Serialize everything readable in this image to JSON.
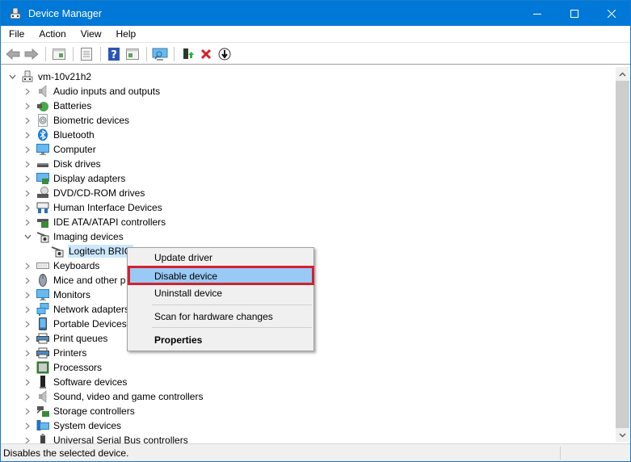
{
  "window": {
    "title": "Device Manager",
    "controls": [
      "minimize",
      "maximize",
      "close"
    ]
  },
  "menubar": {
    "items": [
      "File",
      "Action",
      "View",
      "Help"
    ]
  },
  "toolbar": {
    "buttons": [
      "back-arrow",
      "forward-arrow",
      "show-hide-console-tree",
      "properties",
      "help",
      "action-pane",
      "scan-monitor",
      "update-driver",
      "uninstall-x",
      "disable-download"
    ]
  },
  "tree": {
    "root": "vm-10v21h2",
    "categories": [
      {
        "label": "Audio inputs and outputs",
        "icon": "speaker-icon",
        "expanded": false
      },
      {
        "label": "Batteries",
        "icon": "battery-icon",
        "expanded": false
      },
      {
        "label": "Biometric devices",
        "icon": "fingerprint-icon",
        "expanded": false
      },
      {
        "label": "Bluetooth",
        "icon": "bluetooth-icon",
        "expanded": false
      },
      {
        "label": "Computer",
        "icon": "computer-icon",
        "expanded": false
      },
      {
        "label": "Disk drives",
        "icon": "disk-drive-icon",
        "expanded": false
      },
      {
        "label": "Display adapters",
        "icon": "display-adapter-icon",
        "expanded": false
      },
      {
        "label": "DVD/CD-ROM drives",
        "icon": "dvd-icon",
        "expanded": false
      },
      {
        "label": "Human Interface Devices",
        "icon": "hid-icon",
        "expanded": false
      },
      {
        "label": "IDE ATA/ATAPI controllers",
        "icon": "ide-controller-icon",
        "expanded": false
      },
      {
        "label": "Imaging devices",
        "icon": "camera-icon",
        "expanded": true
      },
      {
        "label": "Keyboards",
        "icon": "keyboard-icon",
        "expanded": false
      },
      {
        "label": "Mice and other p",
        "icon": "mouse-icon",
        "expanded": false
      },
      {
        "label": "Monitors",
        "icon": "monitor-icon",
        "expanded": false
      },
      {
        "label": "Network adapters",
        "icon": "network-icon",
        "expanded": false
      },
      {
        "label": "Portable Devices",
        "icon": "portable-device-icon",
        "expanded": false
      },
      {
        "label": "Print queues",
        "icon": "printer-icon",
        "expanded": false
      },
      {
        "label": "Printers",
        "icon": "printer-icon",
        "expanded": false
      },
      {
        "label": "Processors",
        "icon": "processor-icon",
        "expanded": false
      },
      {
        "label": "Software devices",
        "icon": "software-device-icon",
        "expanded": false
      },
      {
        "label": "Sound, video and game controllers",
        "icon": "speaker-icon",
        "expanded": false
      },
      {
        "label": "Storage controllers",
        "icon": "storage-controller-icon",
        "expanded": false
      },
      {
        "label": "System devices",
        "icon": "system-devices-icon",
        "expanded": false
      },
      {
        "label": "Universal Serial Bus controllers",
        "icon": "usb-icon",
        "expanded": false
      }
    ],
    "imaging_child": "Logitech BRIC"
  },
  "context_menu": {
    "items": [
      {
        "label": "Update driver",
        "bold": false
      },
      {
        "label": "Disable device",
        "bold": false,
        "highlighted": true
      },
      {
        "label": "Uninstall device",
        "bold": false
      },
      {
        "label": "Scan for hardware changes",
        "bold": false
      },
      {
        "label": "Properties",
        "bold": true
      }
    ]
  },
  "statusbar": {
    "text": "Disables the selected device."
  },
  "colors": {
    "titlebar": "#0078d7",
    "highlight": "#99c9f5",
    "annotation_box": "#d3212d",
    "selection": "#cce8ff"
  }
}
